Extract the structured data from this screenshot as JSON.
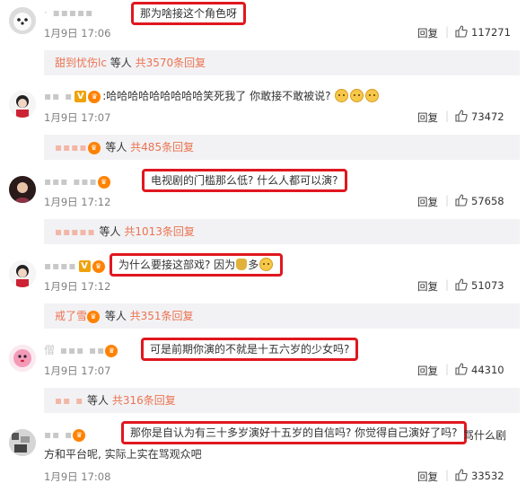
{
  "comments": [
    {
      "username": "·  ▪▪▪▪▪",
      "text": "那为啥接这个角色呀",
      "date": "1月9日 17:06",
      "reply": "回复",
      "likes": "117271",
      "sub": {
        "user": "甜到忧伤lc",
        "deng": " 等人 ",
        "count": "共3570条回复"
      }
    },
    {
      "username": "▪▪ ▪",
      "text": "哈哈哈哈哈哈哈哈哈笑死我了 你敢接不敢被说?",
      "date": "1月9日 17:07",
      "reply": "回复",
      "likes": "73472",
      "sub": {
        "user": "▪▪▪▪",
        "deng": " 等人 ",
        "count": "共485条回复"
      }
    },
    {
      "username": "▪▪▪ ▪▪▪",
      "text": "电视剧的门槛那么低? 什么人都可以演?",
      "date": "1月9日 17:12",
      "reply": "回复",
      "likes": "57658",
      "sub": {
        "user": "▪▪▪▪▪",
        "deng": " 等人 ",
        "count": "共1013条回复"
      }
    },
    {
      "username": "▪▪▪▪",
      "text": "为什么要接这部戏? 因为",
      "text_after": "多",
      "date": "1月9日 17:12",
      "reply": "回复",
      "likes": "51073",
      "sub": {
        "user": "戒了雪",
        "deng": " 等人 ",
        "count": "共351条回复"
      }
    },
    {
      "username": "僧 ▪▪▪ ▪▪",
      "text": "可是前期你演的不就是十五六岁的少女吗?",
      "date": "1月9日 17:07",
      "reply": "回复",
      "likes": "44310",
      "sub": {
        "user": "▪▪ ▪",
        "deng": " 等人 ",
        "count": "共316条回复"
      }
    },
    {
      "username": "▪▪ ▪",
      "text": "那你是自认为有三十多岁演好十五岁的自信吗? 你觉得自己演好了吗?",
      "text_tail": "骂什么剧",
      "text_continued": "方和平台呢, 实际上实在骂观众吧",
      "date": "1月9日 17:08",
      "reply": "回复",
      "likes": "33532"
    }
  ],
  "colors": {
    "highlight_box": "#e0171f",
    "link": "#eb7350",
    "meta": "#808080",
    "subbar_bg": "#f2f2f5"
  },
  "icons": [
    "avatar",
    "verified-v-badge",
    "vip-badge",
    "thumbs-up-icon",
    "doge-emoji",
    "money-bag-emoji"
  ]
}
